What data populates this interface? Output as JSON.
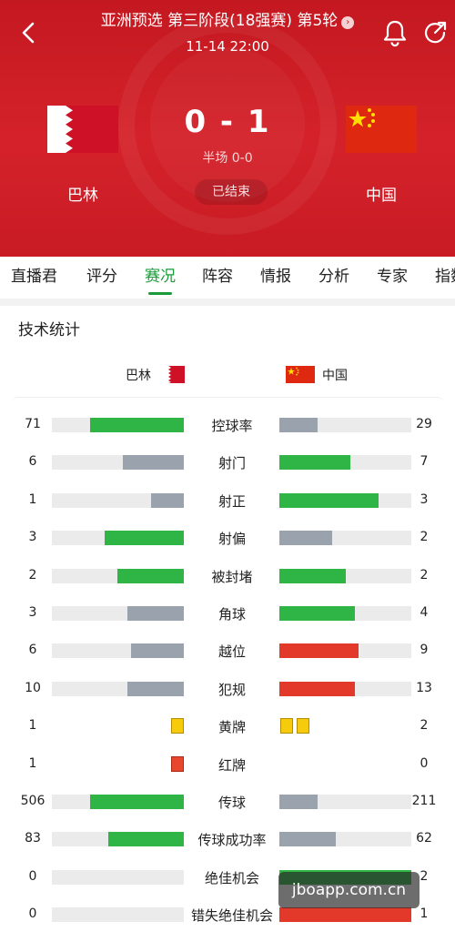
{
  "header": {
    "title": "亚洲预选 第三阶段(18强赛) 第5轮",
    "info_icon": "›",
    "datetime": "11-14 22:00",
    "score": "0 - 1",
    "halftime": "半场 0-0",
    "status": "已结束",
    "home_team": "巴林",
    "away_team": "中国",
    "colors": {
      "primary": "#c41820",
      "accent": "#1a9a3a"
    }
  },
  "icons": {
    "back": "back-arrow-icon",
    "bell": "bell-icon",
    "share": "share-icon"
  },
  "tabs": [
    "直播君",
    "评分",
    "赛况",
    "阵容",
    "情报",
    "分析",
    "专家",
    "指数"
  ],
  "active_tab": "赛况",
  "stats_card": {
    "title": "技术统计",
    "home_legend": "巴林",
    "away_legend": "中国"
  },
  "stats": [
    {
      "label": "控球率",
      "home": "71",
      "away": "29",
      "home_pct": 0.71,
      "away_pct": 0.29,
      "home_color": "#2eb545",
      "away_color": "#9aa3ad"
    },
    {
      "label": "射门",
      "home": "6",
      "away": "7",
      "home_pct": 0.46,
      "away_pct": 0.54,
      "home_color": "#9aa3ad",
      "away_color": "#2eb545"
    },
    {
      "label": "射正",
      "home": "1",
      "away": "3",
      "home_pct": 0.25,
      "away_pct": 0.75,
      "home_color": "#9aa3ad",
      "away_color": "#2eb545"
    },
    {
      "label": "射偏",
      "home": "3",
      "away": "2",
      "home_pct": 0.6,
      "away_pct": 0.4,
      "home_color": "#2eb545",
      "away_color": "#9aa3ad"
    },
    {
      "label": "被封堵",
      "home": "2",
      "away": "2",
      "home_pct": 0.5,
      "away_pct": 0.5,
      "home_color": "#2eb545",
      "away_color": "#2eb545"
    },
    {
      "label": "角球",
      "home": "3",
      "away": "4",
      "home_pct": 0.43,
      "away_pct": 0.57,
      "home_color": "#9aa3ad",
      "away_color": "#2eb545"
    },
    {
      "label": "越位",
      "home": "6",
      "away": "9",
      "home_pct": 0.4,
      "away_pct": 0.6,
      "home_color": "#9aa3ad",
      "away_color": "#e2392a"
    },
    {
      "label": "犯规",
      "home": "10",
      "away": "13",
      "home_pct": 0.43,
      "away_pct": 0.57,
      "home_color": "#9aa3ad",
      "away_color": "#e2392a"
    },
    {
      "label": "黄牌",
      "home": "1",
      "away": "2",
      "type": "yellow-cards"
    },
    {
      "label": "红牌",
      "home": "1",
      "away": "0",
      "type": "red-cards"
    },
    {
      "label": "传球",
      "home": "506",
      "away": "211",
      "home_pct": 0.71,
      "away_pct": 0.29,
      "home_color": "#2eb545",
      "away_color": "#9aa3ad"
    },
    {
      "label": "传球成功率",
      "home": "83",
      "away": "62",
      "home_pct": 0.57,
      "away_pct": 0.43,
      "home_color": "#2eb545",
      "away_color": "#9aa3ad"
    },
    {
      "label": "绝佳机会",
      "home": "0",
      "away": "2",
      "home_pct": 0.0,
      "away_pct": 1.0,
      "home_color": "#2eb545",
      "away_color": "#2eb545"
    },
    {
      "label": "错失绝佳机会",
      "home": "0",
      "away": "1",
      "home_pct": 0.0,
      "away_pct": 1.0,
      "home_color": "#9aa3ad",
      "away_color": "#e2392a"
    }
  ],
  "watermark": "jboapp.com.cn"
}
